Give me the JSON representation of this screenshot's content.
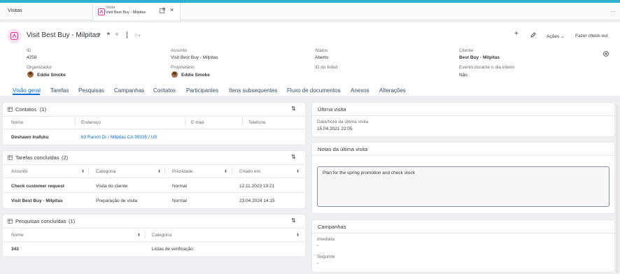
{
  "shell": {
    "title": "Visitas",
    "tab": {
      "type": "Visita",
      "name": "Visit Best Buy - Milpitas"
    },
    "more": "..."
  },
  "header": {
    "title": "Visit Best Buy - Milpitas",
    "tags_icon": "⌔+",
    "actions": {
      "acoes": "Ações",
      "checkout": "Fazer check-out"
    },
    "fields": {
      "id": {
        "label": "ID",
        "value": "4258"
      },
      "assunto": {
        "label": "Assunto",
        "value": "Visit Best Buy - Milpitas"
      },
      "status": {
        "label": "Status",
        "value": "Aberto"
      },
      "cliente": {
        "label": "Cliente",
        "value": "Best Buy - Milpitas"
      },
      "organizador": {
        "label": "Organizador",
        "value": "Eddie Smoke"
      },
      "proprietario": {
        "label": "Proprietário",
        "value": "Eddie Smoke"
      },
      "ticket": {
        "label": "ID do ticket",
        "value": ""
      },
      "evento": {
        "label": "Evento durante o dia inteiro",
        "value": "Não"
      }
    }
  },
  "tabs": [
    "Visão geral",
    "Tarefas",
    "Pesquisas",
    "Campanhas",
    "Contatos",
    "Participantes",
    "Itens subsequentes",
    "Fluxo de documentos",
    "Anexos",
    "Alterações"
  ],
  "contatos": {
    "title": "Contatos",
    "count": "(1)",
    "columns": [
      "Nome",
      "Endereço",
      "E-mail",
      "Telefone"
    ],
    "rows": [
      {
        "nome": "Deshawn Inafuku",
        "endereco": "63 Ranch Dr / Milpitas CA 95035 / US",
        "email": "",
        "telefone": ""
      }
    ]
  },
  "tarefas": {
    "title": "Tarefas concluídas",
    "count": "(2)",
    "columns": [
      "Assunto",
      "Categoria",
      "Prioridade",
      "Criado em"
    ],
    "rows": [
      {
        "assunto": "Check customer request",
        "categoria": "Visita do cliente",
        "prioridade": "Normal",
        "criado": "12.11.2023 19:21"
      },
      {
        "assunto": "Visit Best Buy - Milpitas",
        "categoria": "Preparação de visita",
        "prioridade": "Normal",
        "criado": "23.04.2024 14:15"
      }
    ]
  },
  "pesquisas": {
    "title": "Pesquisas concluídas",
    "count": "(1)",
    "columns": [
      "Nome",
      "Categoria"
    ],
    "rows": [
      {
        "nome": "343",
        "categoria": "Listas de verificação"
      }
    ]
  },
  "ultima_visita": {
    "title": "Última visita",
    "label": "Data/hora da última visita",
    "value": "15.04.2021 22:05"
  },
  "notas": {
    "title": "Notas da última visita",
    "text": "Plan for the spring promotion and check stock"
  },
  "campanhas": {
    "title": "Campanhas",
    "imediata": {
      "label": "Imediata",
      "value": "-"
    },
    "seguinte": {
      "label": "Seguinte",
      "value": "-"
    }
  },
  "colors": {
    "accent": "#0a6ed1",
    "topbar": "#2eafd1",
    "visit_icon": "#d13b8f"
  }
}
